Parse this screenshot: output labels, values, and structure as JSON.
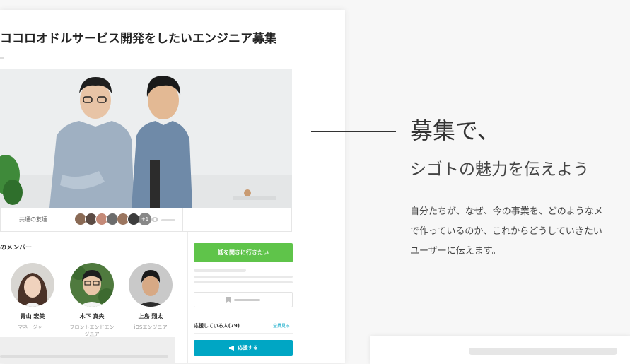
{
  "job": {
    "title": "ココロオドルサービス開発をしたいエンジニア募集"
  },
  "stats": {
    "friends_label": "共通の友達",
    "friends_more": "+1"
  },
  "members": {
    "title": "のメンバー",
    "list": [
      {
        "name": "青山 宏美",
        "role": "マネージャー"
      },
      {
        "name": "木下 真央",
        "role": "フロントエンドエンジニア"
      },
      {
        "name": "上島 翔太",
        "role": "iOSエンジニア"
      }
    ]
  },
  "sidebar": {
    "talk_button": "話を聞きに行きたい",
    "support_label": "応援している人(79)",
    "see_all": "全員見る",
    "cheer_button": "応援する"
  },
  "feature": {
    "headline": "募集で、",
    "subheadline": "シゴトの魅力を伝えよう",
    "description": [
      "自分たちが、なぜ、今の事業を、どのようなメ",
      "で作っているのか、これからどうしていきたい",
      "ユーザーに伝えます。"
    ]
  },
  "colors": {
    "green_button": "#5fc44a",
    "cyan_button": "#00a6c4",
    "link": "#0aa7c7"
  }
}
